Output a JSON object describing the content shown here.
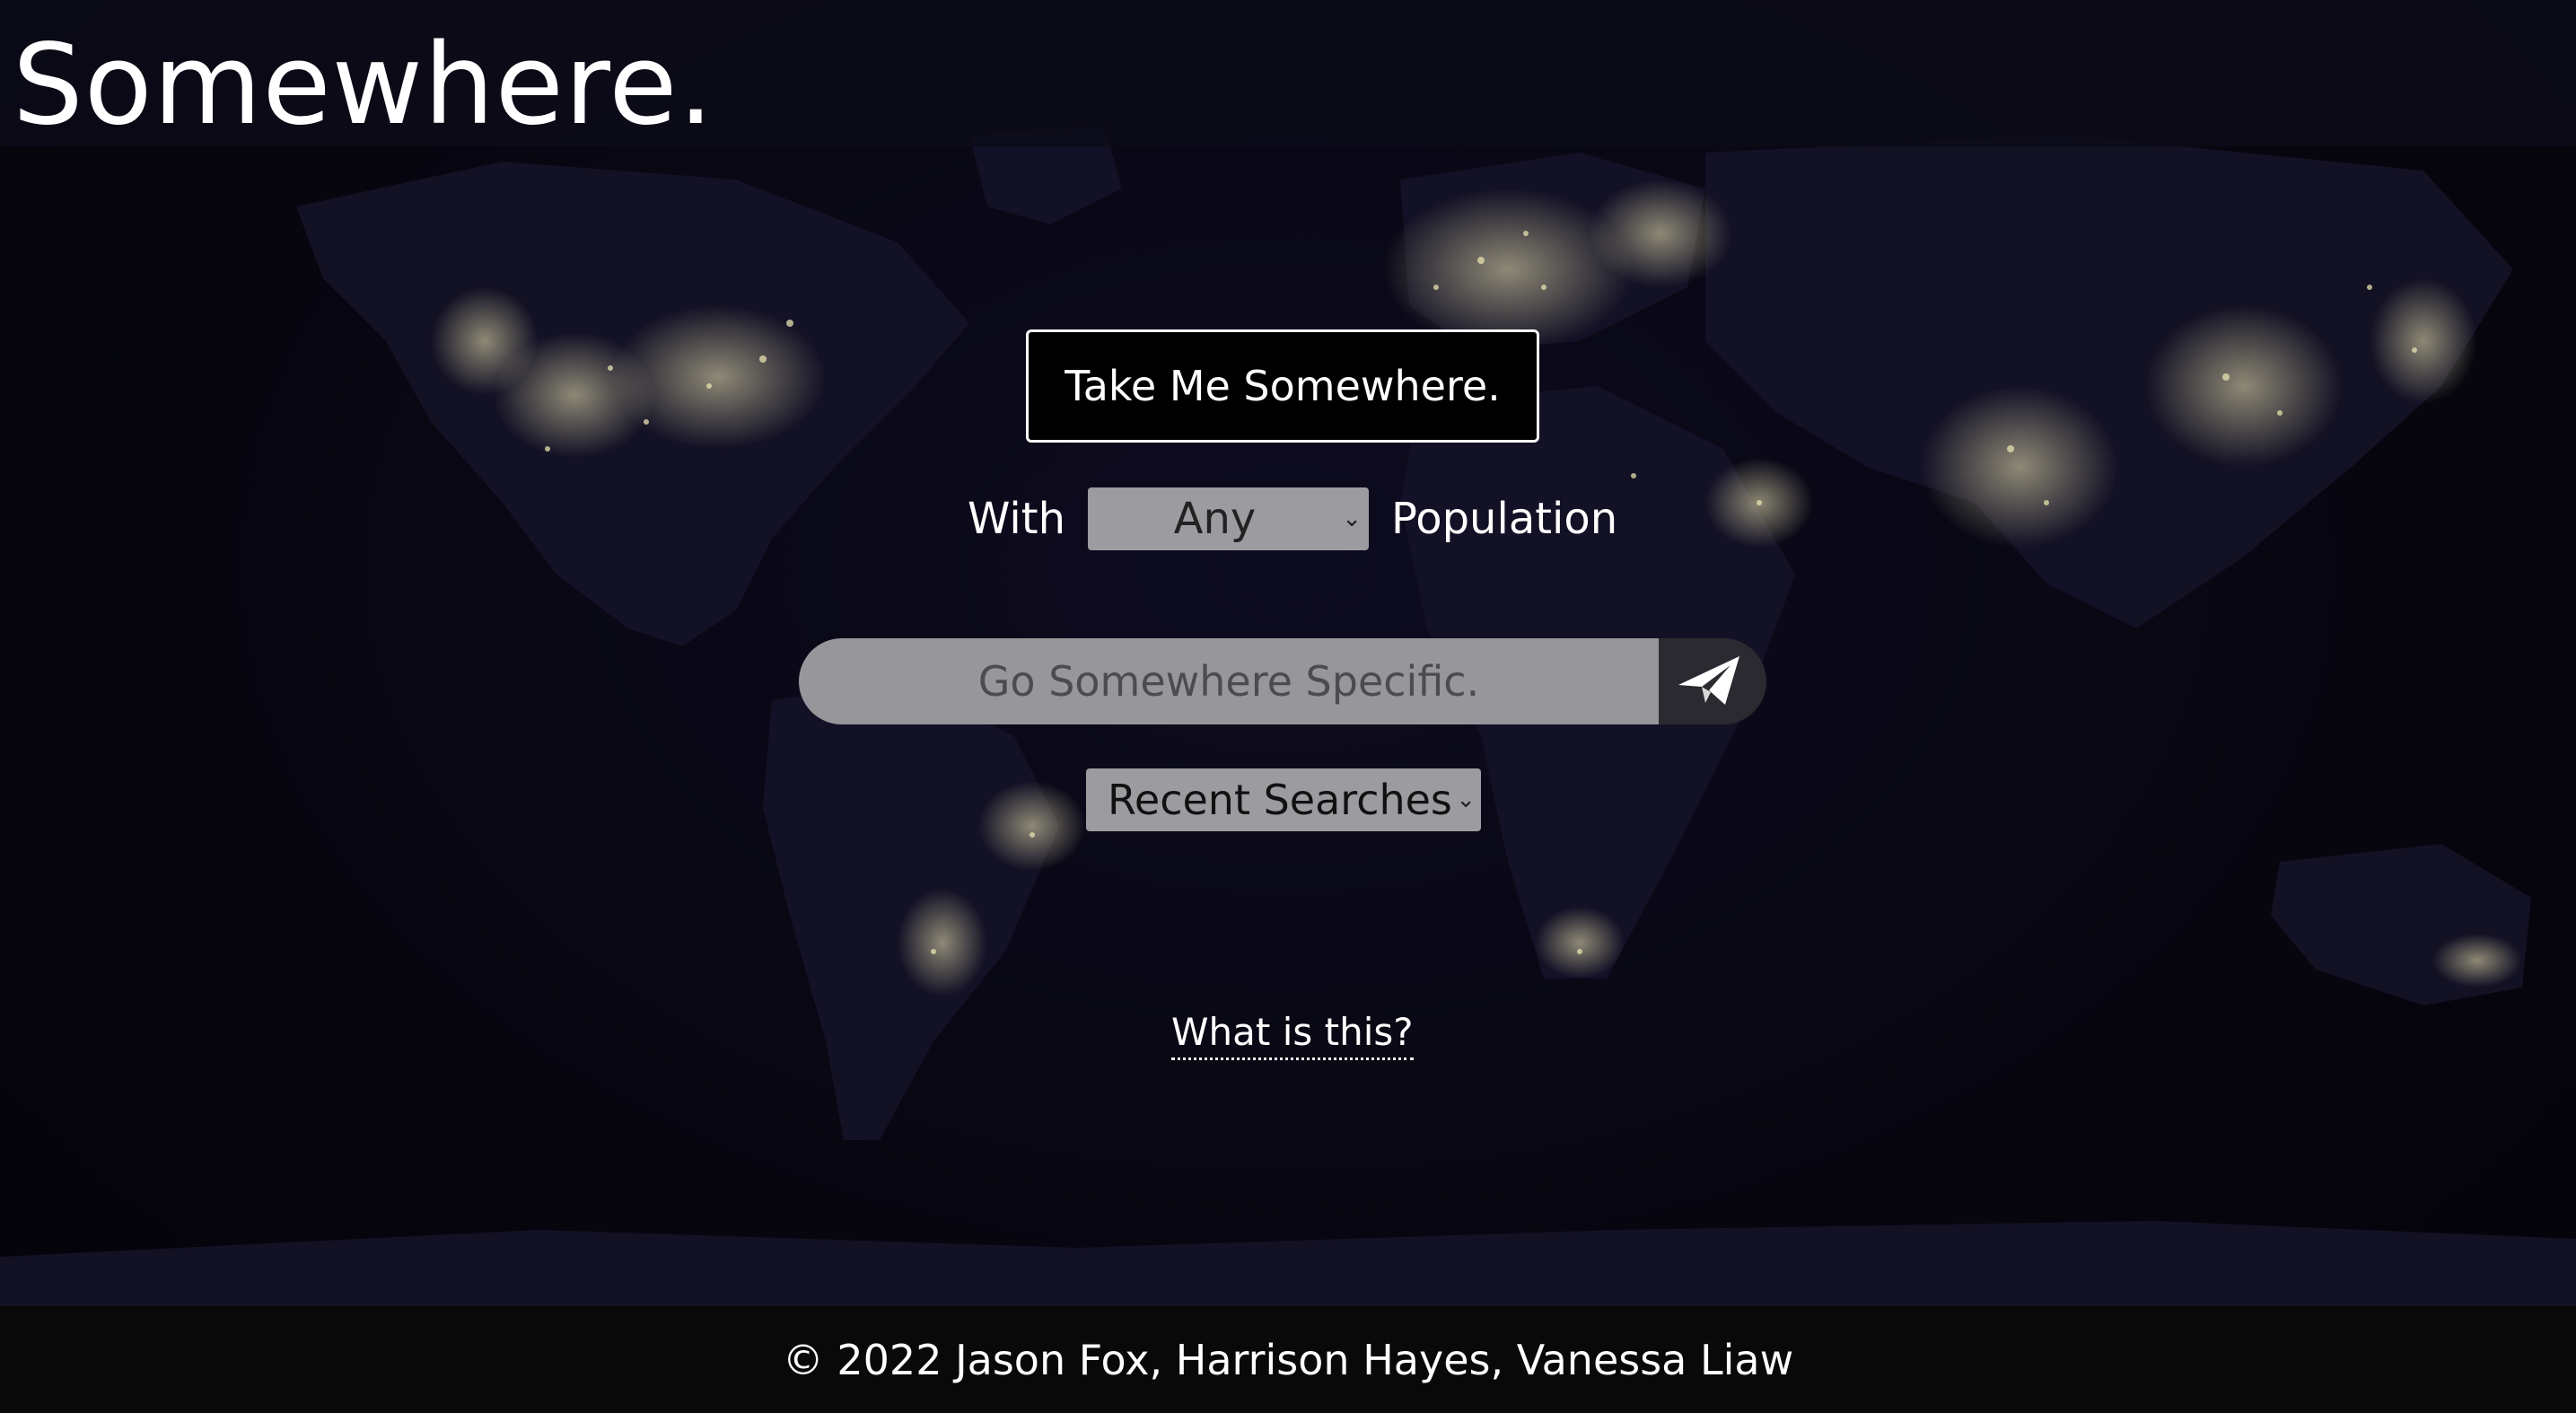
{
  "header": {
    "logo": "Somewhere."
  },
  "main": {
    "take_me_button": "Take Me Somewhere.",
    "population": {
      "prefix": "With",
      "selected": "Any",
      "suffix": "Population"
    },
    "search": {
      "placeholder": "Go Somewhere Specific.",
      "value": "",
      "submit_icon": "paper-plane-icon"
    },
    "recent_searches": {
      "selected": "Recent Searches"
    },
    "what_is_this": "What is this?"
  },
  "footer": {
    "copyright": "© 2022 Jason Fox, Harrison Hayes, Vanessa Liaw"
  },
  "colors": {
    "background": "#07060f",
    "header_bg": "#0c0b18",
    "footer_bg": "#0a0909",
    "control_gray": "#9c9b9f",
    "send_button": "#2b2a31",
    "city_lights": "#e8e2b0"
  }
}
